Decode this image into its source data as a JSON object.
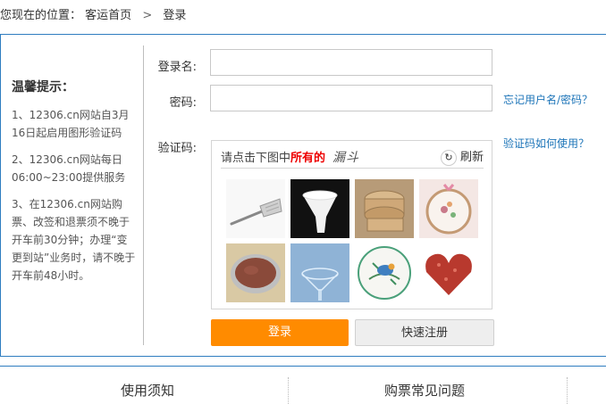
{
  "breadcrumb": {
    "prefix": "您现在的位置：",
    "home": "客运首页",
    "separator": ">",
    "current": "登录"
  },
  "tips": {
    "title": "温馨提示：",
    "items": [
      "1、12306.cn网站自3月16日起启用图形验证码",
      "2、12306.cn网站每日06:00~23:00提供服务",
      "3、在12306.cn网站购票、改签和退票须不晚于开车前30分钟；办理“变更到站”业务时，请不晚于开车前48小时。"
    ]
  },
  "form": {
    "username_label": "登录名:",
    "username_value": "",
    "password_label": "密码:",
    "password_value": "",
    "captcha_label": "验证码:"
  },
  "links": {
    "forgot": "忘记用户名/密码？",
    "captcha_help": "验证码如何使用？"
  },
  "captcha": {
    "prompt_prefix": "请点击下图中",
    "prompt_highlight": "所有的",
    "prompt_scribble": "漏斗",
    "refresh_label": "刷新",
    "refresh_icon": "↻"
  },
  "buttons": {
    "login": "登录",
    "register": "快速注册"
  },
  "bottom": {
    "left_title": "使用须知",
    "right_title": "购票常见问题"
  },
  "colors": {
    "primary_orange": "#ff8b00",
    "border_blue": "#2f7dc0",
    "link_blue": "#1c74b8",
    "highlight_red": "#ee0000"
  }
}
